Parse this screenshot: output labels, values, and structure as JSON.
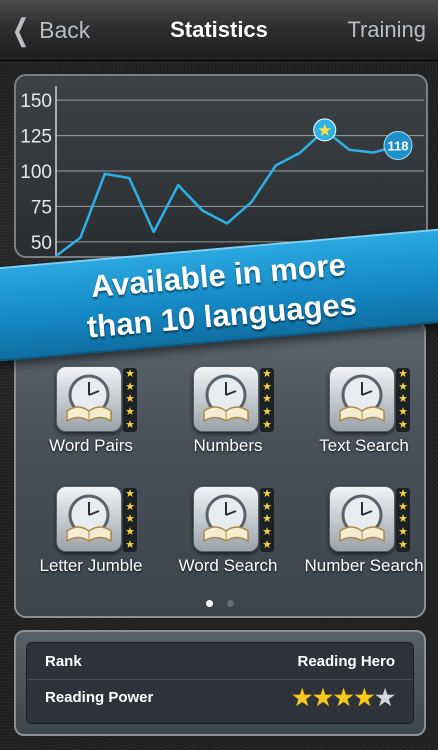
{
  "nav": {
    "back_label": "Back",
    "title": "Statistics",
    "right_label": "Training"
  },
  "chart_data": {
    "type": "line",
    "y_ticks": [
      50,
      75,
      100,
      125,
      150
    ],
    "ylim": [
      40,
      160
    ],
    "values": [
      40,
      53,
      98,
      95,
      57,
      90,
      72,
      63,
      78,
      104,
      113,
      129,
      115,
      113,
      118
    ],
    "star_point_index": 11,
    "last_value_label": "118",
    "line_color": "#2bb3e8"
  },
  "banner": {
    "line1": "Available in more",
    "line2": "than 10 languages"
  },
  "games": [
    {
      "label": "Word Pairs",
      "stars": 5
    },
    {
      "label": "Numbers",
      "stars": 5
    },
    {
      "label": "Text Search",
      "stars": 5
    },
    {
      "label": "Letter Jumble",
      "stars": 5
    },
    {
      "label": "Word Search",
      "stars": 5
    },
    {
      "label": "Number Search",
      "stars": 5
    }
  ],
  "pagination": {
    "pages": 2,
    "current": 1
  },
  "info": {
    "rank_label": "Rank",
    "rank_value": "Reading Hero",
    "power_label": "Reading Power",
    "power_stars": 4,
    "power_max": 5
  }
}
